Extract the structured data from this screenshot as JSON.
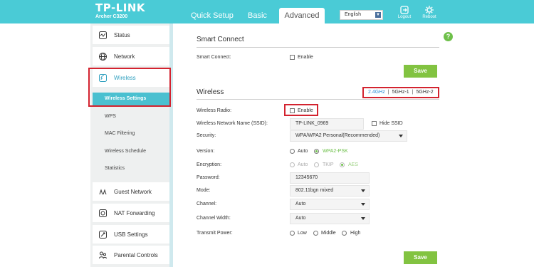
{
  "header": {
    "logo": "TP-LINK",
    "model": "Archer C3200",
    "tabs": [
      "Quick Setup",
      "Basic",
      "Advanced"
    ],
    "language": "English",
    "logout": "Logout",
    "reboot": "Reboot"
  },
  "sidebar": {
    "items": [
      {
        "label": "Status",
        "icon": "status-icon"
      },
      {
        "label": "Network",
        "icon": "globe-icon"
      },
      {
        "label": "Wireless",
        "icon": "wireless-icon"
      },
      {
        "label": "Guest Network",
        "icon": "guest-network-icon"
      },
      {
        "label": "NAT Forwarding",
        "icon": "nat-forwarding-icon"
      },
      {
        "label": "USB Settings",
        "icon": "usb-icon"
      },
      {
        "label": "Parental Controls",
        "icon": "parental-controls-icon"
      }
    ],
    "subitems": [
      "Wireless Settings",
      "WPS",
      "MAC Filtering",
      "Wireless Schedule",
      "Statistics"
    ]
  },
  "smart_connect": {
    "title": "Smart Connect",
    "label": "Smart Connect:",
    "checkbox_label": "Enable",
    "save": "Save"
  },
  "wireless": {
    "title": "Wireless",
    "bands": [
      "2.4GHz",
      "5GHz-1",
      "5GHz-2"
    ],
    "radio_label": "Wireless Radio:",
    "radio_checkbox": "Enable",
    "ssid_label": "Wireless Network Name (SSID):",
    "ssid_value": "TP-LINK_0969",
    "hide_ssid": "Hide SSID",
    "security_label": "Security:",
    "security_value": "WPA/WPA2 Personal(Recommended)",
    "version_label": "Version:",
    "version_options": [
      "Auto",
      "WPA2-PSK"
    ],
    "encryption_label": "Encryption:",
    "encryption_options": [
      "Auto",
      "TKIP",
      "AES"
    ],
    "password_label": "Password:",
    "password_value": "12345670",
    "mode_label": "Mode:",
    "mode_value": "802.11bgn mixed",
    "channel_label": "Channel:",
    "channel_value": "Auto",
    "channel_width_label": "Channel Width:",
    "channel_width_value": "Auto",
    "tx_power_label": "Transmit Power:",
    "tx_power_options": [
      "Low",
      "Middle",
      "High"
    ],
    "save": "Save"
  },
  "help": "?",
  "colors": {
    "header": "#4acbd6",
    "active_sub": "#4ac0d0",
    "save": "#82c341",
    "highlight": "#d3232f"
  }
}
